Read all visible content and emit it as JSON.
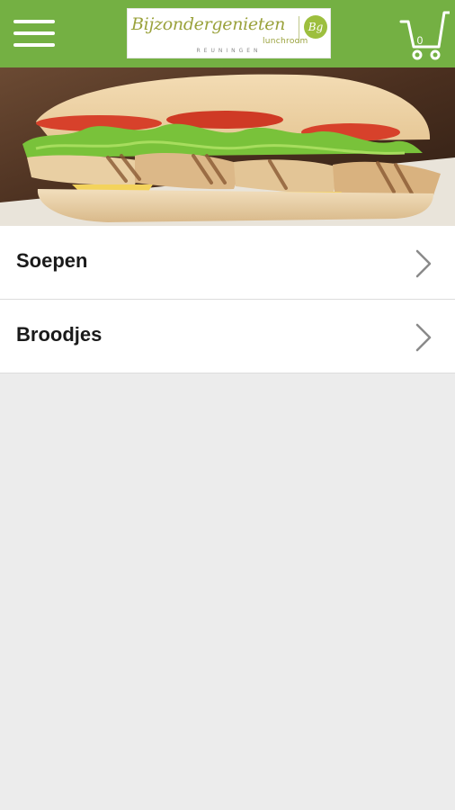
{
  "header": {
    "logo_text": "Bijzondergenieten",
    "logo_sub": "lunchroom",
    "logo_badge": "Bg",
    "logo_place": "REUNINGEN",
    "cart_count": "0",
    "accent_color": "#74b043"
  },
  "menu": {
    "items": [
      {
        "label": "Soepen"
      },
      {
        "label": "Broodjes"
      }
    ]
  },
  "icons": [
    "hamburger-menu-icon",
    "shopping-cart-icon",
    "chevron-right-icon"
  ]
}
